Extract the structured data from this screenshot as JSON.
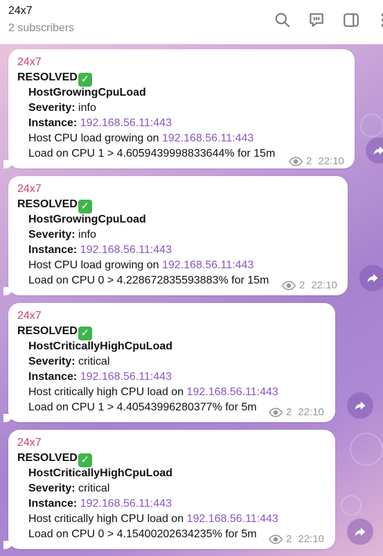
{
  "header": {
    "title": "24x7",
    "subtitle": "2 subscribers",
    "icons": [
      "search-icon",
      "comments-icon",
      "sidebar-icon",
      "more-icon"
    ]
  },
  "messages": [
    {
      "sender": "24x7",
      "status": "RESOLVED",
      "alert_name": "HostGrowingCpuLoad",
      "severity_label": "Severity:",
      "severity": "info",
      "instance_label": "Instance:",
      "instance": "192.168.56.11:443",
      "summary_text": "Host CPU load growing on",
      "summary_link": "192.168.56.11:443",
      "detail": "Load on CPU 1 > 4.6059439998833644% for 15m",
      "views": "2",
      "time": "22:10"
    },
    {
      "sender": "24x7",
      "status": "RESOLVED",
      "alert_name": "HostGrowingCpuLoad",
      "severity_label": "Severity:",
      "severity": "info",
      "instance_label": "Instance:",
      "instance": "192.168.56.11:443",
      "summary_text": "Host CPU load growing on",
      "summary_link": "192.168.56.11:443",
      "detail": "Load on CPU 0 > 4.228672835593883% for 15m",
      "views": "2",
      "time": "22:10"
    },
    {
      "sender": "24x7",
      "status": "RESOLVED",
      "alert_name": "HostCriticallyHighCpuLoad",
      "severity_label": "Severity:",
      "severity": "critical",
      "instance_label": "Instance:",
      "instance": "192.168.56.11:443",
      "summary_text": "Host critically high CPU load on",
      "summary_link": "192.168.56.11:443",
      "detail": "Load on CPU 1 > 4.40543996280377% for 5m",
      "views": "2",
      "time": "22:10"
    },
    {
      "sender": "24x7",
      "status": "RESOLVED",
      "alert_name": "HostCriticallyHighCpuLoad",
      "severity_label": "Severity:",
      "severity": "critical",
      "instance_label": "Instance:",
      "instance": "192.168.56.11:443",
      "summary_text": "Host critically high CPU load on",
      "summary_link": "192.168.56.11:443",
      "detail": "Load on CPU 0 > 4.15400202634235% for 5m",
      "views": "2",
      "time": "22:10"
    }
  ],
  "colors": {
    "sender": "#cc3f70",
    "link": "#8a55c4",
    "check_emoji": "#3fb54d"
  }
}
